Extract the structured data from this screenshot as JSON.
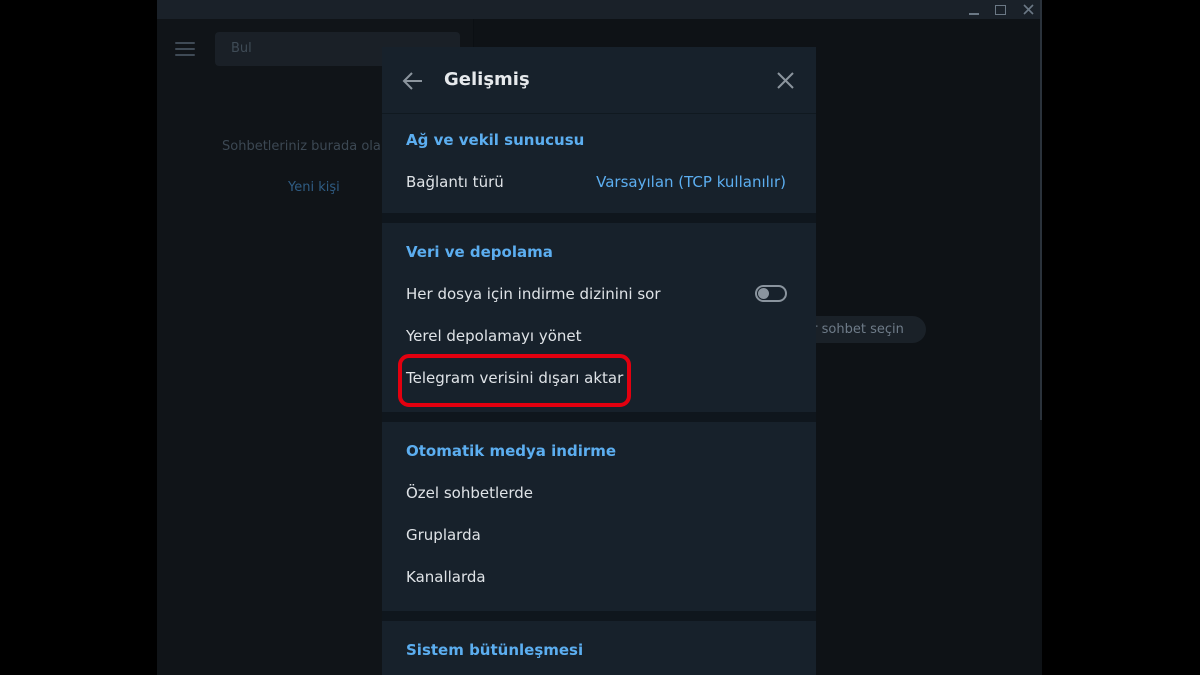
{
  "left_panel": {
    "search_placeholder": "Bul",
    "empty_text": "Sohbetleriniz burada ola",
    "new_contact_link": "Yeni kişi"
  },
  "right_panel": {
    "select_chat_text": "r sohbet seçin"
  },
  "dialog": {
    "title": "Gelişmiş",
    "sections": [
      {
        "title": "Ağ ve vekil sunucusu",
        "rows": [
          {
            "label": "Bağlantı türü",
            "value": "Varsayılan (TCP kullanılır)"
          }
        ]
      },
      {
        "title": "Veri ve depolama",
        "rows": [
          {
            "label": "Her dosya için indirme dizinini sor",
            "toggle": false
          },
          {
            "label": "Yerel depolamayı yönet"
          },
          {
            "label": "Telegram verisini dışarı aktar",
            "highlighted": true
          }
        ]
      },
      {
        "title": "Otomatik medya indirme",
        "rows": [
          {
            "label": "Özel sohbetlerde"
          },
          {
            "label": "Gruplarda"
          },
          {
            "label": "Kanallarda"
          }
        ]
      },
      {
        "title": "Sistem bütünleşmesi",
        "rows": []
      }
    ]
  },
  "colors": {
    "accent": "#5caef0",
    "dialog_bg": "#17212b",
    "highlight": "#e3000f"
  },
  "icons": {
    "back": "arrow-left-icon",
    "close": "close-icon",
    "menu": "hamburger-menu-icon"
  }
}
